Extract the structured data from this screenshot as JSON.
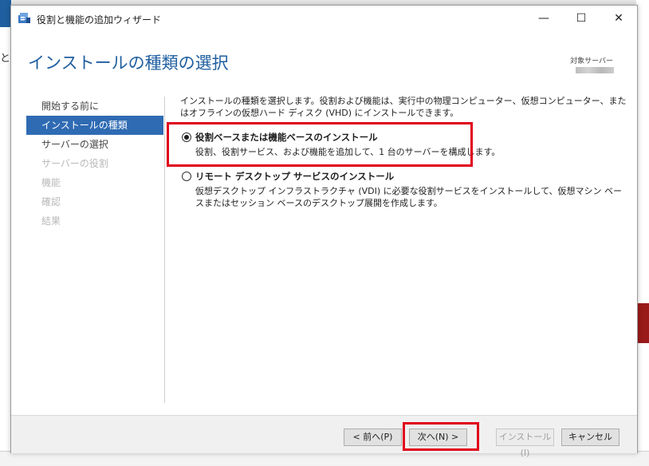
{
  "window": {
    "title": "役割と機能の追加ウィザード",
    "controls": {
      "minimize": "—",
      "maximize": "☐",
      "close": "✕"
    }
  },
  "header": {
    "page_title": "インストールの種類の選択",
    "destination_label": "対象サーバー"
  },
  "nav": {
    "items": [
      {
        "label": "開始する前に",
        "state": "normal"
      },
      {
        "label": "インストールの種類",
        "state": "active"
      },
      {
        "label": "サーバーの選択",
        "state": "normal"
      },
      {
        "label": "サーバーの役割",
        "state": "disabled"
      },
      {
        "label": "機能",
        "state": "disabled"
      },
      {
        "label": "確認",
        "state": "disabled"
      },
      {
        "label": "結果",
        "state": "disabled"
      }
    ]
  },
  "content": {
    "description": "インストールの種類を選択します。役割および機能は、実行中の物理コンピューター、仮想コンピューター、またはオフラインの仮想ハード ディスク (VHD) にインストールできます。",
    "options": [
      {
        "label": "役割ベースまたは機能ベースのインストール",
        "description": "役割、役割サービス、および機能を追加して、1 台のサーバーを構成します。",
        "selected": true
      },
      {
        "label": "リモート デスクトップ サービスのインストール",
        "description": "仮想デスクトップ インフラストラクチャ (VDI) に必要な役割サービスをインストールして、仮想マシン ベースまたはセッション ベースのデスクトップ展開を作成します。",
        "selected": false
      }
    ]
  },
  "footer": {
    "prev_label": "< 前へ(P)",
    "next_label": "次へ(N) >",
    "install_label": "インストール(I)",
    "cancel_label": "キャンセル"
  },
  "colors": {
    "accent": "#2f6bb3",
    "title_blue": "#1f5fa0",
    "highlight_red": "#e0001a"
  }
}
